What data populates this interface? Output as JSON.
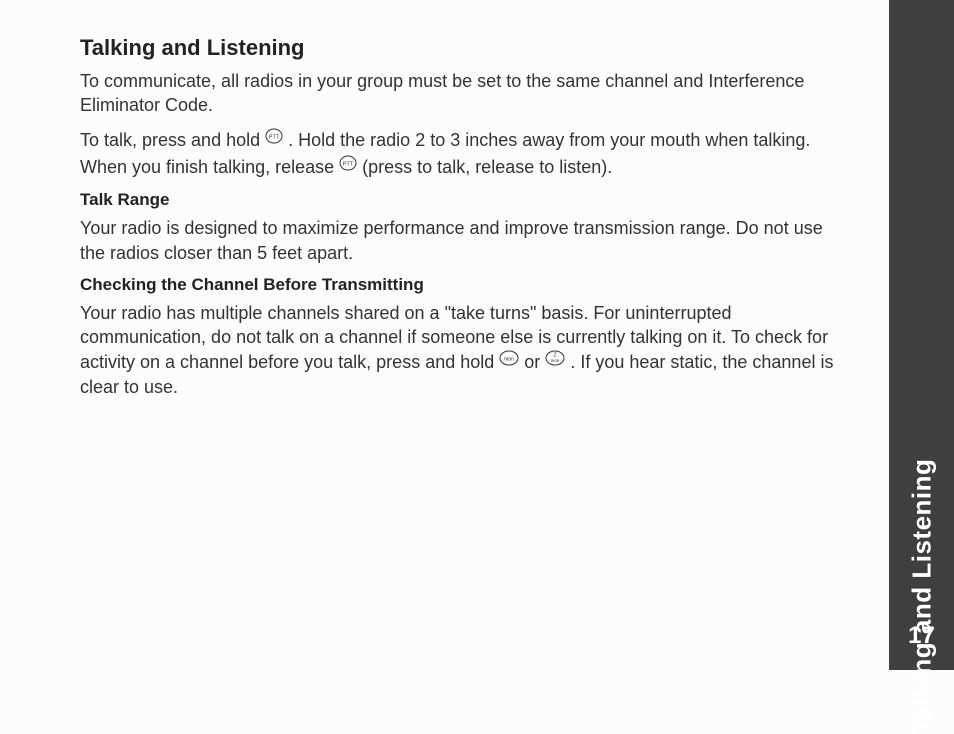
{
  "sidebar": {
    "section": "Talking and Listening",
    "pageNumber": "17"
  },
  "title": "Talking and Listening",
  "intro": "To communicate, all radios in your group must be set to the same channel and Interference Eliminator Code.",
  "talk": {
    "part1": "To talk, press and hold ",
    "part2": ". Hold the radio 2 to 3 inches away from your mouth when talking.",
    "release1": "When you finish talking, release ",
    "release2": " (press to talk, release to listen)."
  },
  "talkRange": {
    "heading": "Talk Range",
    "body": "Your radio is designed to maximize performance and improve transmission range. Do not use the radios closer than 5 feet apart."
  },
  "checking": {
    "heading": "Checking the Channel Before Transmitting",
    "body1": "Your radio has multiple channels shared on a \"take turns\" basis. For uninterrupted communication, do not talk on a channel if someone else is currently talking on it. To check for activity on a channel before you talk, press and hold ",
    "body2": "or ",
    "body3": " . If you hear static, the channel is clear to use."
  },
  "icons": {
    "ptt": "PTT",
    "mon": "mon",
    "monZ": "mon"
  }
}
